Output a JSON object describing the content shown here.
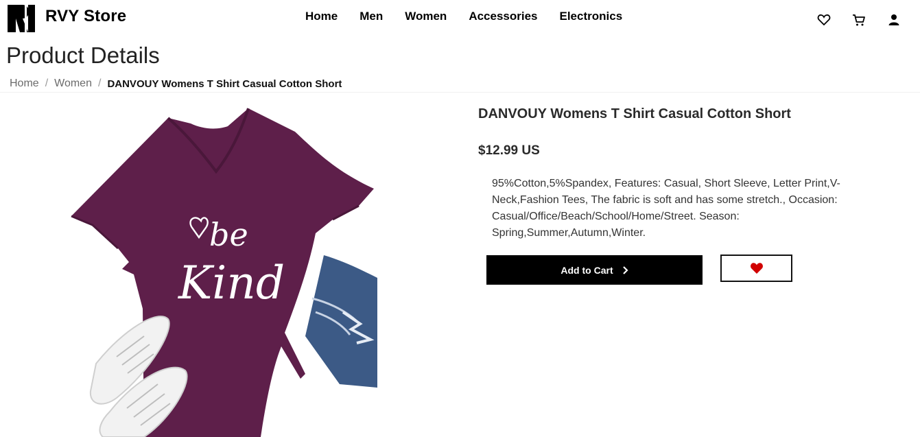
{
  "header": {
    "brand": "RVY Store",
    "nav": [
      "Home",
      "Men",
      "Women",
      "Accessories",
      "Electronics"
    ],
    "icons": [
      "heart-icon",
      "cart-icon",
      "user-icon"
    ]
  },
  "page_title": "Product Details",
  "breadcrumb": {
    "items": [
      "Home",
      "Women"
    ],
    "separator": "/",
    "current": "DANVOUY Womens T Shirt Casual Cotton Short"
  },
  "product": {
    "name": "DANVOUY Womens T Shirt Casual Cotton Short",
    "price": "$12.99 US",
    "description": "95%Cotton,5%Spandex, Features: Casual, Short Sleeve, Letter Print,V-Neck,Fashion Tees, The fabric is soft and has some stretch., Occasion: Casual/Office/Beach/School/Home/Street. Season: Spring,Summer,Autumn,Winter.",
    "image_text": [
      "be",
      "Kind"
    ],
    "add_to_cart_label": "Add to Cart",
    "wishlist_icon": "heart-icon"
  },
  "colors": {
    "shirt": "#5e1f4a",
    "button_bg": "#000000",
    "heart_red": "#d10000"
  }
}
